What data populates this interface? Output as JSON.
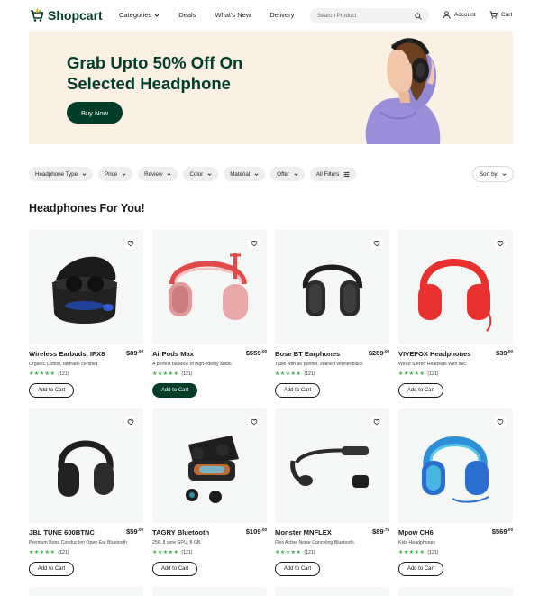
{
  "header": {
    "brand": "Shopcart",
    "nav": [
      {
        "label": "Categories"
      },
      {
        "label": "Deals"
      },
      {
        "label": "What's New"
      },
      {
        "label": "Delivery"
      }
    ],
    "search_placeholder": "Search Product",
    "account_label": "Account",
    "cart_label": "Cart"
  },
  "banner": {
    "title": "Grab Upto 50% Off On Selected Headphone",
    "cta": "Buy Now"
  },
  "filters": [
    "Headphone Type",
    "Price",
    "Review",
    "Color",
    "Material",
    "Offer",
    "All Filters"
  ],
  "sort_label": "Sort by",
  "section_title": "Headphones For You!",
  "products": [
    {
      "name": "Wireless Earbuds, IPX8",
      "price": "$89",
      "cents": ".00",
      "desc": "Organic Cotton, fairtrade certified",
      "reviews": "(121)",
      "cta": "Add to Cart"
    },
    {
      "name": "AirPods Max",
      "price": "$559",
      "cents": ".00",
      "desc": "A perfect balance of high-fidelity audio",
      "reviews": "(121)",
      "cta": "Add to Cart"
    },
    {
      "name": "Bose BT Earphones",
      "price": "$289",
      "cents": ".00",
      "desc": "Table with air purifier, stained venner/black",
      "reviews": "(121)",
      "cta": "Add to Cart"
    },
    {
      "name": "VIVEFOX Headphones",
      "price": "$39",
      "cents": ".00",
      "desc": "Wired Stereo Headsets With Mic",
      "reviews": "(121)",
      "cta": "Add to Cart"
    },
    {
      "name": "JBL TUNE 600BTNC",
      "price": "$59",
      "cents": ".00",
      "desc": "Premium Bone Conduction Open Ear Bluetooth",
      "reviews": "(121)",
      "cta": "Add to Cart"
    },
    {
      "name": "TAGRY Bluetooth",
      "price": "$109",
      "cents": ".00",
      "desc": "256, 8 core GPU, 8 GB",
      "reviews": "(121)",
      "cta": "Add to Cart"
    },
    {
      "name": "Monster MNFLEX",
      "price": "$89",
      "cents": ".75",
      "desc": "Flex Active Noise Canceling Bluetooth",
      "reviews": "(121)",
      "cta": "Add to Cart"
    },
    {
      "name": "Mpow CH6",
      "price": "$569",
      "cents": ".00",
      "desc": "Kids Headphones",
      "reviews": "(121)",
      "cta": "Add to Cart"
    }
  ],
  "colors": {
    "brand": "#003d29",
    "star": "#3aa948",
    "banner_bg": "#fbf0e4",
    "card_bg": "#f5f6f6"
  }
}
